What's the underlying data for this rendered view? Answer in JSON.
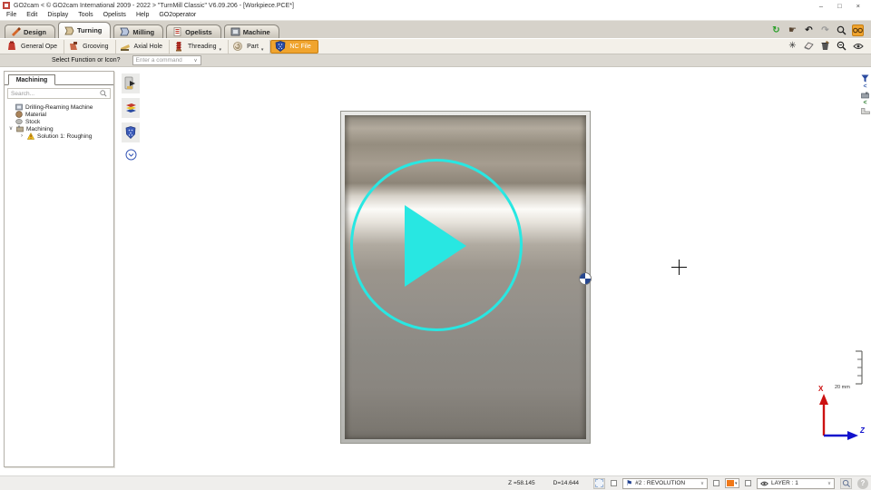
{
  "window": {
    "title": "GO2cam < © GO2cam International 2009 - 2022 >     \"TurnMill Classic\"   V6.09.206 - [Workpiece.PCE*]",
    "controls": {
      "minimize": "–",
      "maximize": "□",
      "close": "×"
    }
  },
  "menu": {
    "items": [
      {
        "label": "File"
      },
      {
        "label": "Edit"
      },
      {
        "label": "Display"
      },
      {
        "label": "Tools"
      },
      {
        "label": "Opelists"
      },
      {
        "label": "Help"
      },
      {
        "label": "GO2operator"
      }
    ]
  },
  "ribbon": {
    "tabs": [
      {
        "label": "Design"
      },
      {
        "label": "Turning"
      },
      {
        "label": "Milling"
      },
      {
        "label": "Opelists"
      },
      {
        "label": "Machine"
      }
    ],
    "tools": [
      {
        "label": "General Ope"
      },
      {
        "label": "Grooving"
      },
      {
        "label": "Axial Hole"
      },
      {
        "label": "Threading"
      },
      {
        "label": "Part"
      },
      {
        "label": "NC File"
      }
    ]
  },
  "command_bar": {
    "prompt": "Select Function or Icon?",
    "dropdown_value": "Enter a command"
  },
  "sidebar": {
    "tab": "Machining",
    "search_placeholder": "Search...",
    "tree": [
      {
        "label": "Drilling-Reaming Machine"
      },
      {
        "label": "Material"
      },
      {
        "label": "Stock"
      },
      {
        "label": "Machining"
      },
      {
        "label": "Solution 1: Roughing"
      }
    ]
  },
  "viewport": {
    "scale_label": "20 mm",
    "axis_vertical": "X",
    "axis_horizontal": "Z"
  },
  "status_bar": {
    "z_value": "Z =58.145",
    "d_value": "D=14.644",
    "revolution_value": "#2 : REVOLUTION",
    "layer_value": "LAYER : 1"
  },
  "icons": {
    "sync": "↻",
    "pointer": "☛",
    "undo": "↶",
    "redo": "↷",
    "burst": "✳",
    "flag": "⚑",
    "caret": "▾",
    "dd": "∨",
    "chev_left": "<",
    "exp_open": "v",
    "exp_closed": "›",
    "search": "🔍",
    "question": "?",
    "minus_glyph": "–"
  }
}
